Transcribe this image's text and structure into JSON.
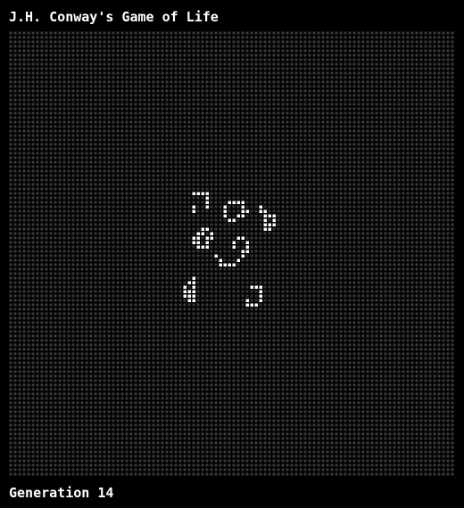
{
  "app": {
    "title": "J.H. Conway's Game of Life"
  },
  "status": {
    "generation_text": "Generation 14"
  },
  "colors": {
    "background": "#000000",
    "dead_cell": "#3a3a3a",
    "live_cell": "#ffffff",
    "text": "#ffffff"
  },
  "grid": {
    "columns": 100,
    "rows": 100,
    "live_cells": [
      [
        41,
        36
      ],
      [
        42,
        36
      ],
      [
        43,
        36
      ],
      [
        44,
        36
      ],
      [
        44,
        37
      ],
      [
        44,
        38
      ],
      [
        41,
        39
      ],
      [
        44,
        39
      ],
      [
        41,
        40
      ],
      [
        49,
        38
      ],
      [
        50,
        38
      ],
      [
        51,
        38
      ],
      [
        52,
        38
      ],
      [
        48,
        39
      ],
      [
        52,
        39
      ],
      [
        48,
        40
      ],
      [
        52,
        40
      ],
      [
        53,
        40
      ],
      [
        48,
        41
      ],
      [
        51,
        41
      ],
      [
        52,
        41
      ],
      [
        49,
        42
      ],
      [
        50,
        42
      ],
      [
        56,
        39
      ],
      [
        56,
        40
      ],
      [
        57,
        40
      ],
      [
        57,
        41
      ],
      [
        58,
        41
      ],
      [
        59,
        41
      ],
      [
        57,
        42
      ],
      [
        59,
        42
      ],
      [
        57,
        43
      ],
      [
        58,
        43
      ],
      [
        59,
        43
      ],
      [
        57,
        44
      ],
      [
        58,
        44
      ],
      [
        43,
        44
      ],
      [
        44,
        44
      ],
      [
        42,
        45
      ],
      [
        43,
        45
      ],
      [
        45,
        45
      ],
      [
        41,
        46
      ],
      [
        42,
        46
      ],
      [
        44,
        46
      ],
      [
        45,
        46
      ],
      [
        41,
        47
      ],
      [
        42,
        47
      ],
      [
        44,
        47
      ],
      [
        42,
        48
      ],
      [
        43,
        48
      ],
      [
        44,
        48
      ],
      [
        51,
        46
      ],
      [
        52,
        46
      ],
      [
        50,
        47
      ],
      [
        53,
        47
      ],
      [
        50,
        48
      ],
      [
        53,
        48
      ],
      [
        52,
        49
      ],
      [
        53,
        49
      ],
      [
        46,
        50
      ],
      [
        52,
        50
      ],
      [
        47,
        51
      ],
      [
        51,
        51
      ],
      [
        47,
        52
      ],
      [
        48,
        52
      ],
      [
        49,
        52
      ],
      [
        50,
        52
      ],
      [
        41,
        55
      ],
      [
        40,
        56
      ],
      [
        41,
        56
      ],
      [
        39,
        57
      ],
      [
        41,
        57
      ],
      [
        39,
        58
      ],
      [
        40,
        58
      ],
      [
        41,
        58
      ],
      [
        39,
        59
      ],
      [
        40,
        59
      ],
      [
        41,
        59
      ],
      [
        40,
        60
      ],
      [
        41,
        60
      ],
      [
        54,
        57
      ],
      [
        55,
        57
      ],
      [
        56,
        57
      ],
      [
        56,
        58
      ],
      [
        56,
        59
      ],
      [
        53,
        60
      ],
      [
        56,
        60
      ],
      [
        53,
        61
      ],
      [
        54,
        61
      ],
      [
        55,
        61
      ]
    ]
  }
}
